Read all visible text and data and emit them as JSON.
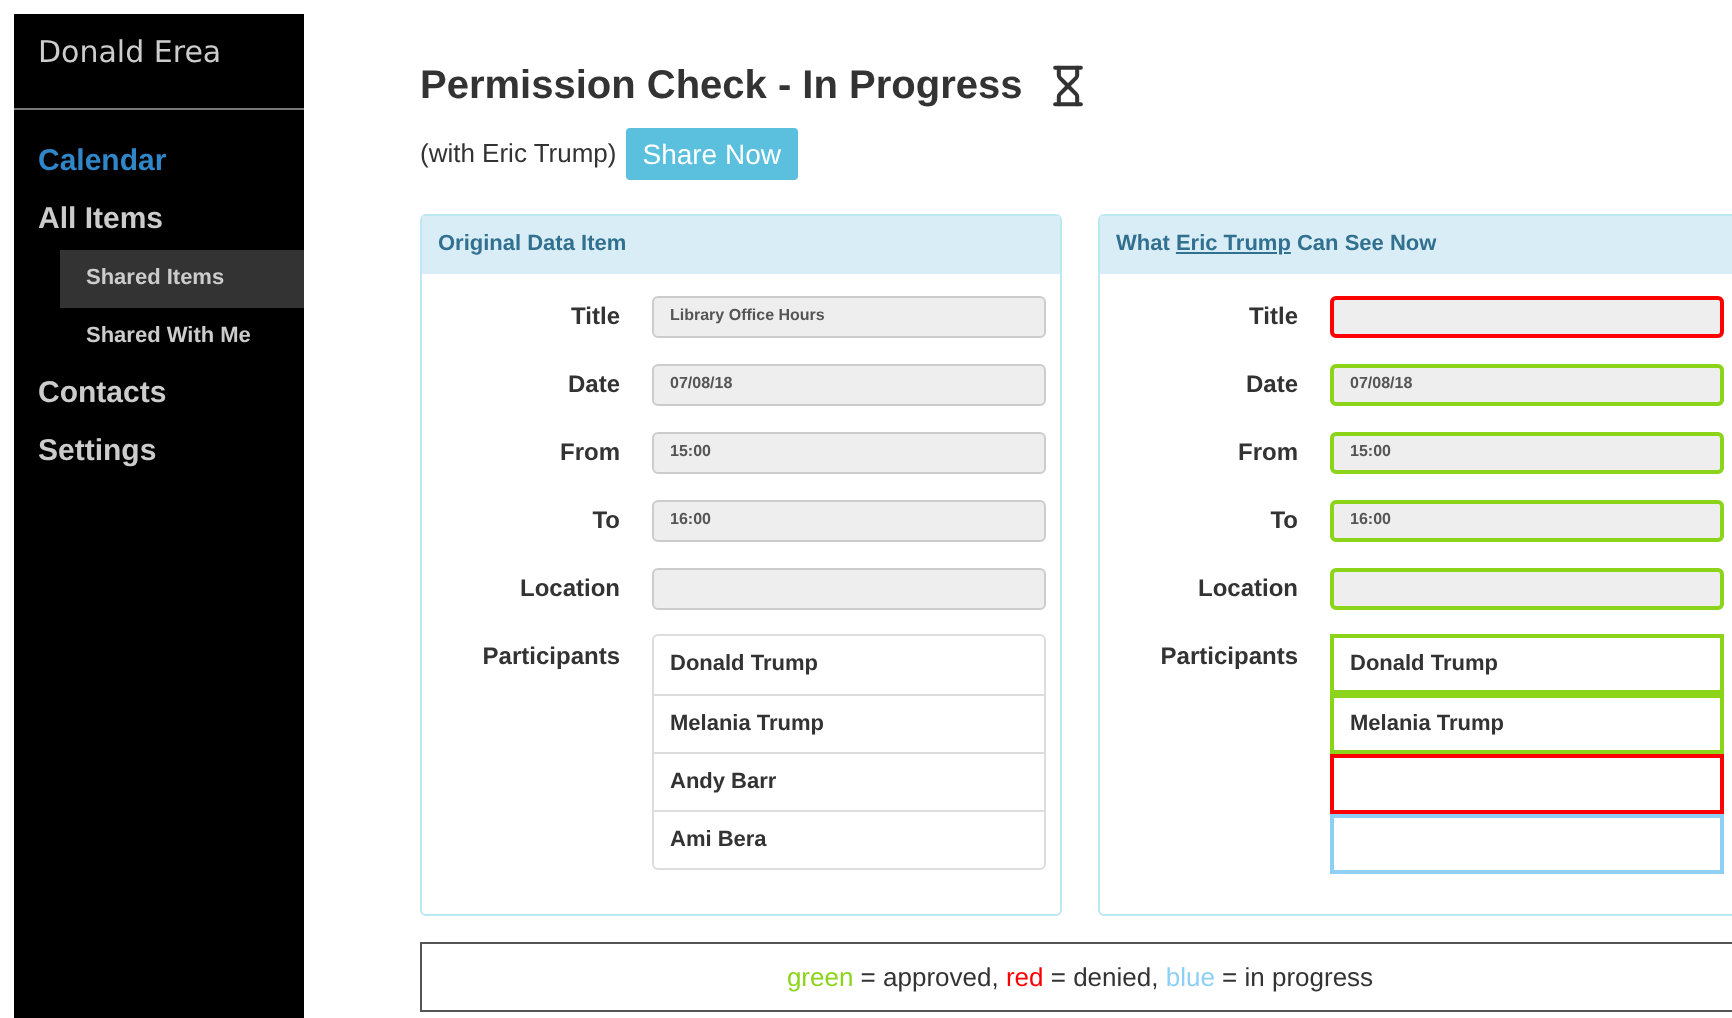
{
  "sidebar": {
    "brand": "Donald Erea",
    "items": [
      {
        "label": "Calendar",
        "selected": true
      },
      {
        "label": "All Items",
        "selected": false,
        "children": [
          {
            "label": "Shared Items",
            "selected": true
          },
          {
            "label": "Shared With Me",
            "selected": false
          }
        ]
      },
      {
        "label": "Contacts",
        "selected": false
      },
      {
        "label": "Settings",
        "selected": false
      }
    ]
  },
  "header": {
    "title": "Permission Check - In Progress",
    "subtitle": "(with Eric Trump)",
    "share_button": "Share Now"
  },
  "original": {
    "heading": "Original Data Item",
    "fields": [
      {
        "label": "Title",
        "value": "Library Office Hours"
      },
      {
        "label": "Date",
        "value": "07/08/18"
      },
      {
        "label": "From",
        "value": "15:00"
      },
      {
        "label": "To",
        "value": "16:00"
      },
      {
        "label": "Location"
      }
    ],
    "participants_label": "Participants",
    "participants": [
      "Donald Trump",
      "Melania Trump",
      "Andy Barr",
      "Ami Bera"
    ]
  },
  "preview": {
    "heading_before": "What",
    "heading_link": "Eric Trump",
    "heading_after": "Can See Now",
    "fields": [
      {
        "label": "Title",
        "color": "#ff0000"
      },
      {
        "label": "Date",
        "value": "07/08/18",
        "color": "#8bd41a"
      },
      {
        "label": "From",
        "value": "15:00",
        "color": "#8bd41a"
      },
      {
        "label": "To",
        "value": "16:00",
        "color": "#8bd41a"
      },
      {
        "label": "Location",
        "color": "#8bd41a"
      }
    ],
    "participants_label": "Participants",
    "participants": [
      {
        "name": "Donald Trump",
        "color": "#8bd41a"
      },
      {
        "name": "Melania Trump",
        "color": "#8bd41a"
      },
      {
        "color": "#ff0000"
      },
      {
        "color": "#8ecff5"
      }
    ]
  },
  "legend": [
    {
      "word": "green",
      "color": "#8bd41a",
      "meaning": "= approved,"
    },
    {
      "word": "red",
      "color": "#ff0000",
      "meaning": "= denied,"
    },
    {
      "word": "blue",
      "color": "#8ecff5",
      "meaning": "= in progress"
    }
  ]
}
